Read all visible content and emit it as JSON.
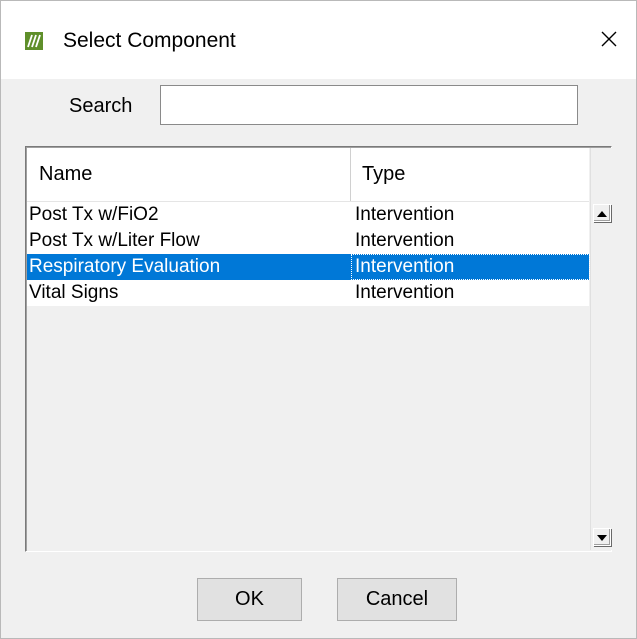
{
  "window": {
    "title": "Select Component",
    "app_icon": "app-logo-icon",
    "close_icon": "close-icon"
  },
  "search": {
    "label": "Search",
    "value": "",
    "placeholder": ""
  },
  "grid": {
    "columns": [
      "Name",
      "Type"
    ],
    "rows": [
      {
        "name": "Post Tx w/FiO2",
        "type": "Intervention",
        "selected": false
      },
      {
        "name": "Post Tx w/Liter Flow",
        "type": "Intervention",
        "selected": false
      },
      {
        "name": "Respiratory Evaluation",
        "type": "Intervention",
        "selected": true
      },
      {
        "name": "Vital Signs",
        "type": "Intervention",
        "selected": false
      }
    ],
    "selection_color": "#0078d7",
    "scroll_up_icon": "scroll-up-arrow-icon",
    "scroll_down_icon": "scroll-down-arrow-icon"
  },
  "buttons": {
    "ok": "OK",
    "cancel": "Cancel"
  }
}
